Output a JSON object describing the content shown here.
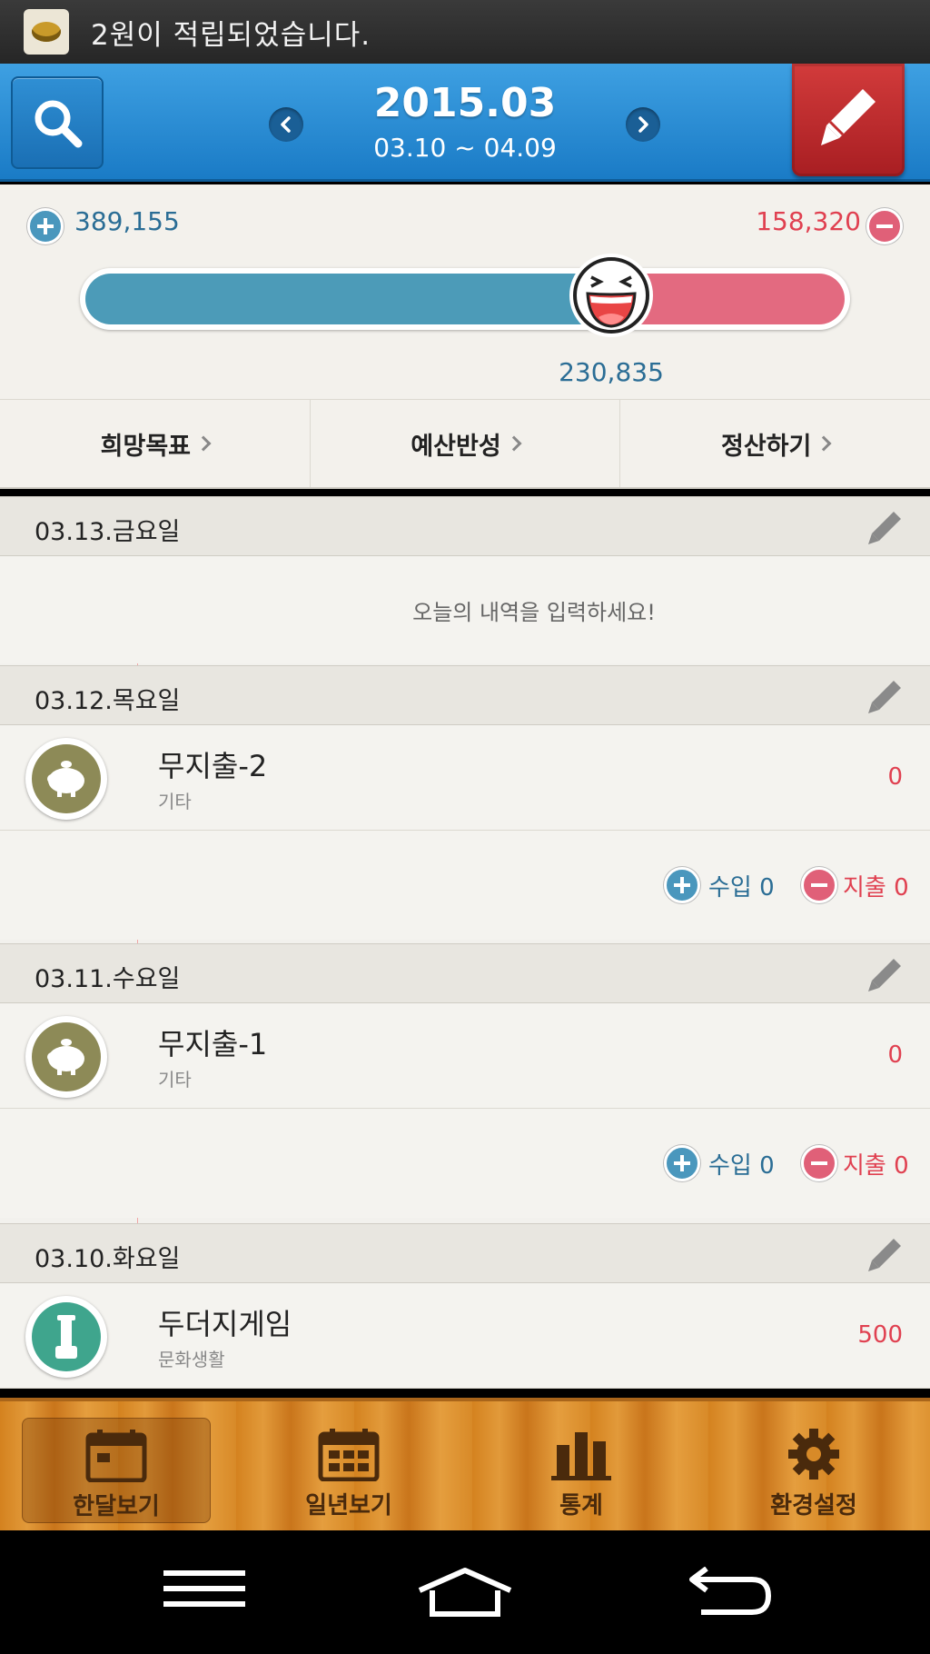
{
  "status_bar": {
    "notification_text": "2원이 적립되었습니다."
  },
  "header": {
    "month": "2015.03",
    "range": "03.10 ~ 04.09"
  },
  "summary": {
    "income": "389,155",
    "expense": "158,320",
    "balance": "230,835",
    "income_ratio": 0.71,
    "links": [
      "희망목표",
      "예산반성",
      "정산하기"
    ]
  },
  "days": [
    {
      "date": "03.13.금요일",
      "empty_message": "오늘의 내역을 입력하세요!"
    },
    {
      "date": "03.12.목요일",
      "entry": {
        "title": "무지출-2",
        "category": "기타",
        "amount": "0"
      },
      "totals": {
        "income_label": "수입 0",
        "expense_label": "지출 0"
      }
    },
    {
      "date": "03.11.수요일",
      "entry": {
        "title": "무지출-1",
        "category": "기타",
        "amount": "0"
      },
      "totals": {
        "income_label": "수입 0",
        "expense_label": "지출 0"
      }
    },
    {
      "date": "03.10.화요일",
      "entry": {
        "title": "두더지게임",
        "category": "문화생활",
        "amount": "500"
      }
    }
  ],
  "tabs": [
    {
      "label": "한달보기",
      "icon": "calendar-month-icon",
      "active": true
    },
    {
      "label": "일년보기",
      "icon": "calendar-year-icon",
      "active": false
    },
    {
      "label": "통계",
      "icon": "chart-bars-icon",
      "active": false
    },
    {
      "label": "환경설정",
      "icon": "gear-icon",
      "active": false
    }
  ],
  "colors": {
    "header_blue": "#2a8ad2",
    "income_blue": "#4c9bb8",
    "expense_red": "#e36a80",
    "edit_red": "#c12d2f",
    "tab_wood": "#d88a28"
  }
}
